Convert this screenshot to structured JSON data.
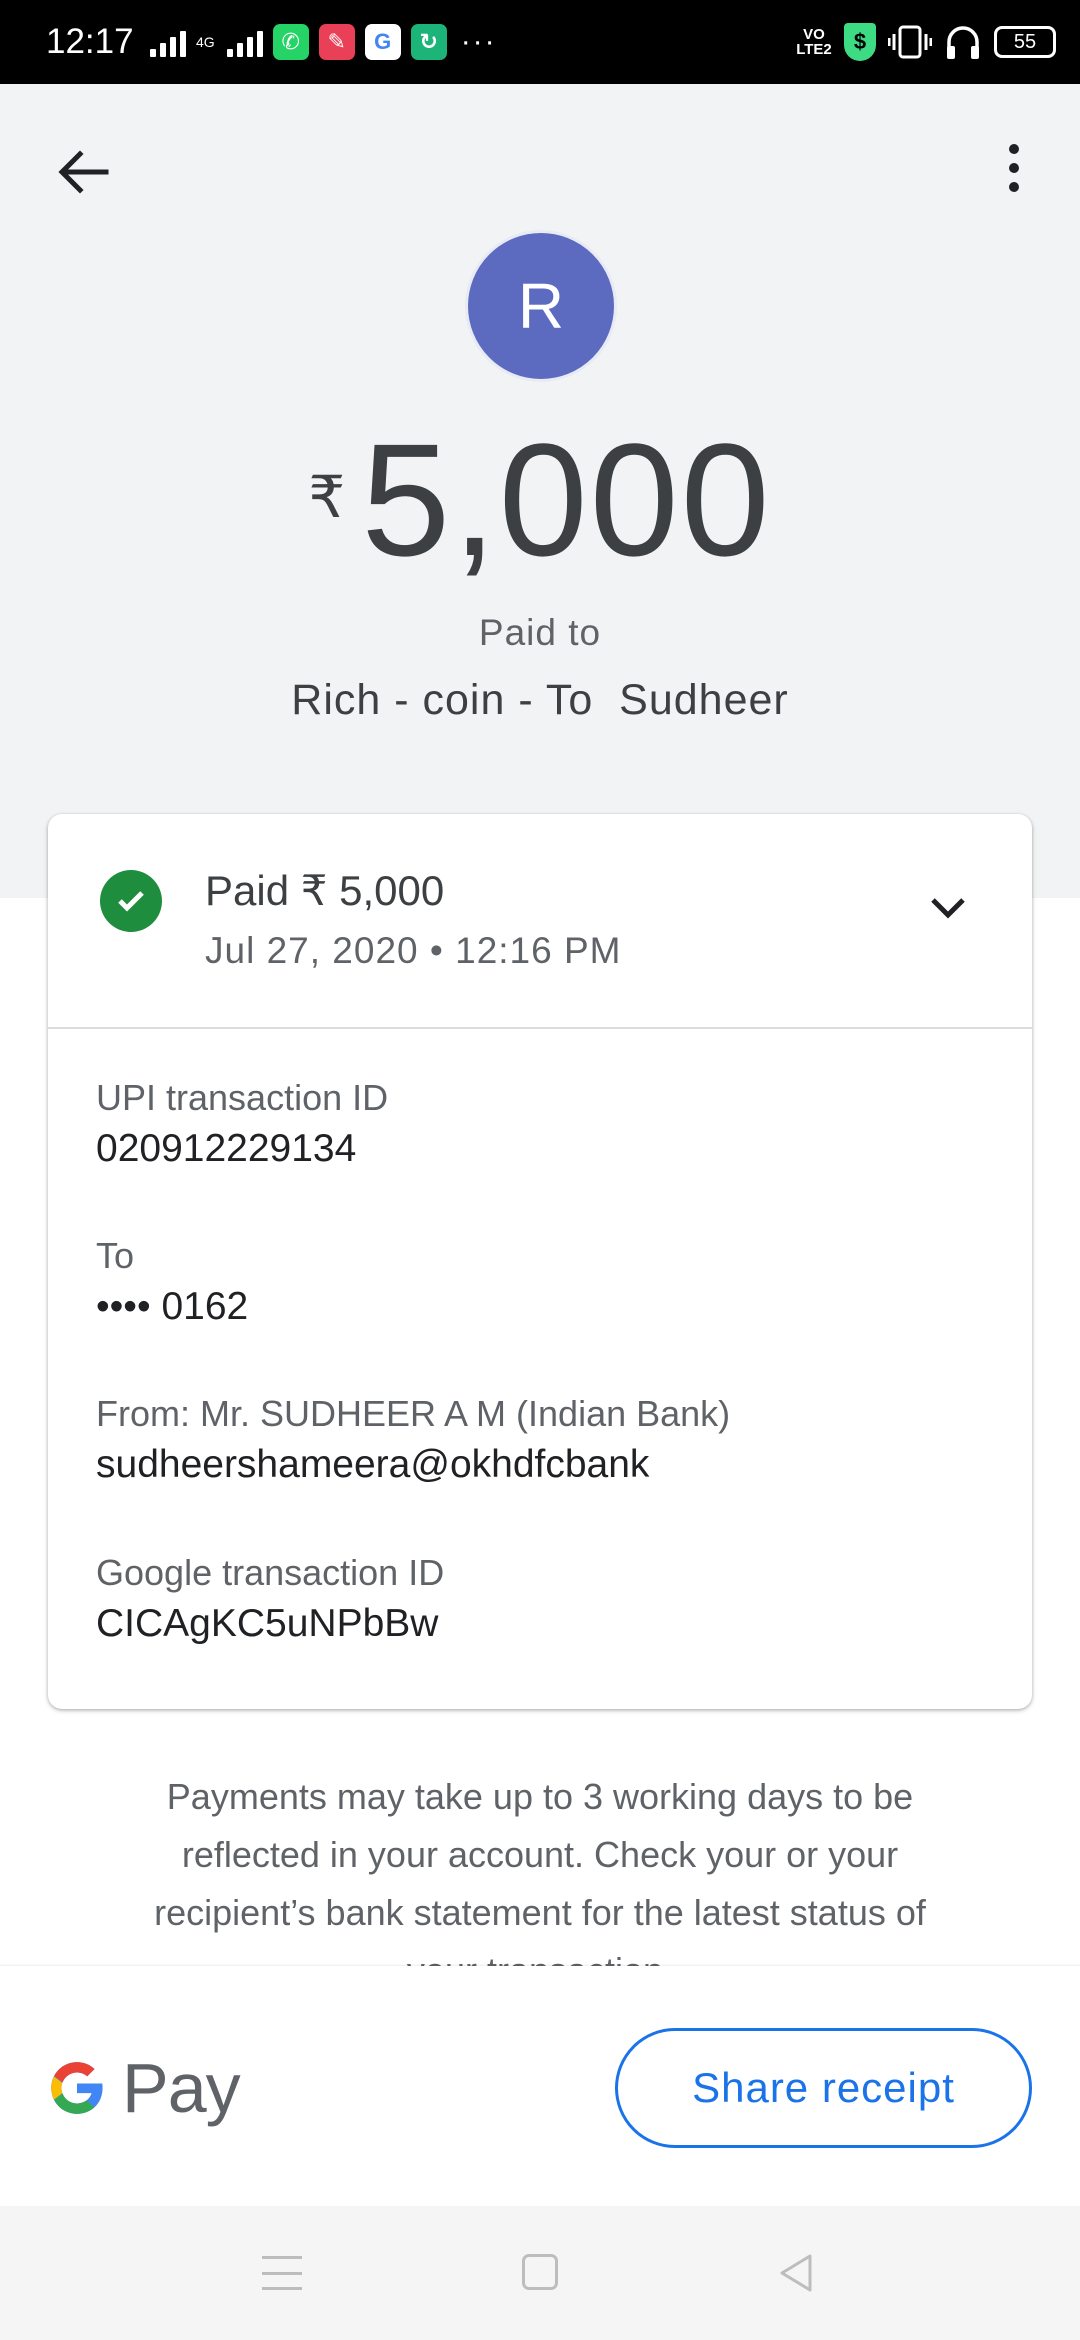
{
  "status_bar": {
    "time": "12:17",
    "network": "4G",
    "volte": "VO LTE2",
    "battery": "55",
    "more": "···"
  },
  "header": {
    "back_icon": "arrow-back-icon",
    "menu_icon": "more-vert-icon",
    "avatar_letter": "R",
    "avatar_color": "#5c6bc0",
    "currency_symbol": "₹",
    "amount": "5,000",
    "paid_to_label": "Paid to",
    "payee_name": "Rich - coin - To  Sudheer"
  },
  "transaction": {
    "status": "Paid ₹ 5,000",
    "datetime": "Jul 27, 2020 • 12:16 PM",
    "status_color": "#1e8e3e",
    "details": [
      {
        "label": "UPI transaction ID",
        "value": "020912229134"
      },
      {
        "label": "To",
        "value": "•••• 0162"
      },
      {
        "label": "From: Mr. SUDHEER A M (Indian Bank)",
        "value": "sudheershameera@okhdfcbank"
      },
      {
        "label": "Google transaction ID",
        "value": "CICAgKC5uNPbBw"
      }
    ]
  },
  "notice": "Payments may take up to 3 working days to be reflected in your account. Check your or your recipient’s bank statement for the latest status of your transaction.",
  "footer": {
    "brand": "Pay",
    "share_label": "Share receipt",
    "accent_color": "#1a73e8"
  }
}
